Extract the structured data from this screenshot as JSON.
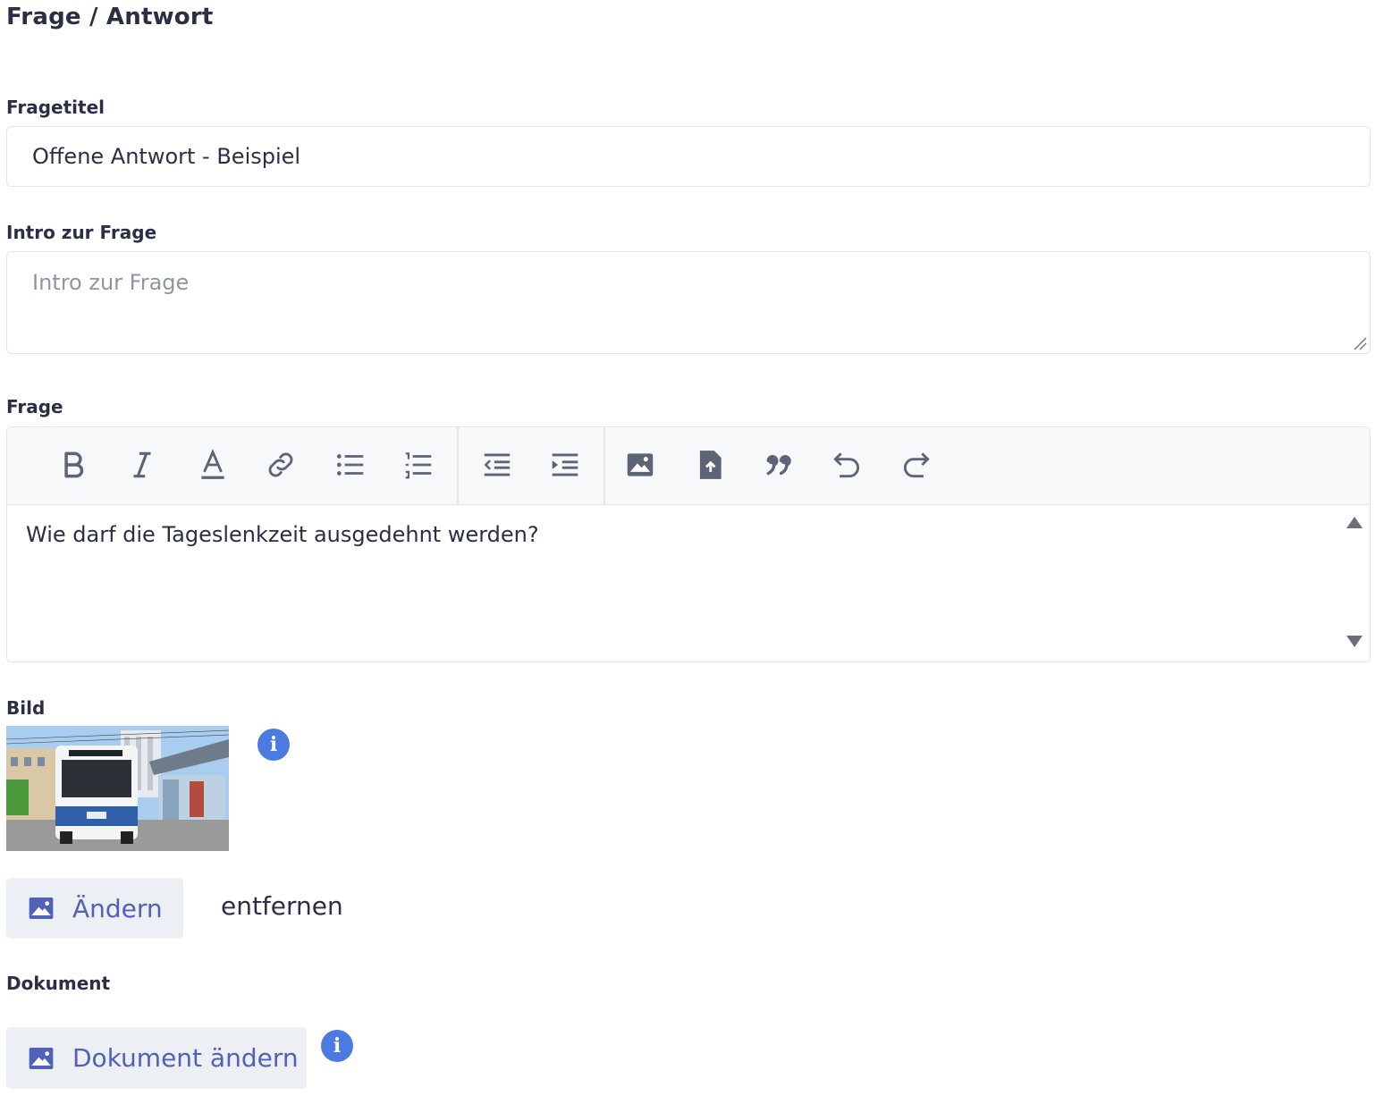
{
  "page": {
    "heading": "Frage / Antwort"
  },
  "fields": {
    "title_label": "Fragetitel",
    "title_value": "Offene Antwort - Beispiel",
    "intro_label": "Intro zur Frage",
    "intro_placeholder": "Intro zur Frage",
    "question_label": "Frage",
    "question_text": "Wie darf die Tageslenkzeit ausgedehnt werden?",
    "image_label": "Bild",
    "document_label": "Dokument"
  },
  "toolbar": {
    "buttons": [
      "bold-icon",
      "italic-icon",
      "text-color-icon",
      "link-icon",
      "bullet-list-icon",
      "numbered-list-icon",
      "outdent-icon",
      "indent-icon",
      "image-icon",
      "file-upload-icon",
      "blockquote-icon",
      "undo-icon",
      "redo-icon"
    ]
  },
  "image_actions": {
    "change_label": "Ändern",
    "remove_label": "entfernen"
  },
  "document_actions": {
    "change_label": "Dokument ändern"
  },
  "colors": {
    "accent": "#5160b8",
    "info": "#4b7be0",
    "text": "#2a2f45",
    "icon": "#5d6478"
  }
}
